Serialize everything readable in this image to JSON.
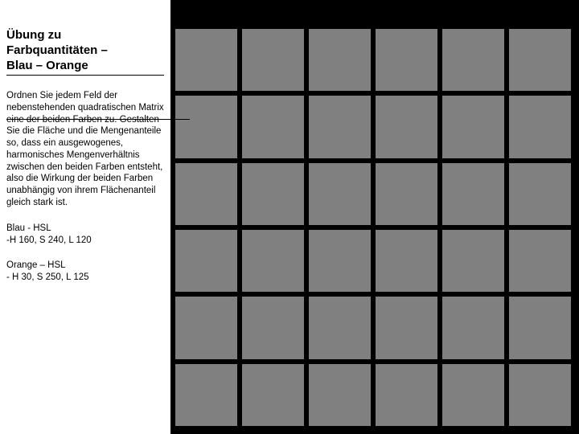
{
  "sidebar": {
    "title_line1": "Übung zu",
    "title_line2": "Farbquantitäten –",
    "title_line3": "Blau – Orange",
    "instructions": "Ordnen Sie jedem Feld der nebenstehenden quadratischen Matrix eine der beiden Farben zu. Gestalten Sie die Fläche und die Mengenanteile so, dass ein ausgewogenes, harmonisches Mengenverhältnis zwischen den beiden Farben entsteht, also die Wirkung der beiden Farben unabhängig von ihrem Flächenanteil gleich stark ist.",
    "blue_label": "Blau - HSL",
    "blue_values": "-H 160, S 240, L 120",
    "orange_label": "Orange – HSL",
    "orange_values": "- H 30, S 250, L 125"
  },
  "grid": {
    "rows": 6,
    "cols": 6,
    "cell_color": "#808080",
    "gap_color": "#000000"
  }
}
